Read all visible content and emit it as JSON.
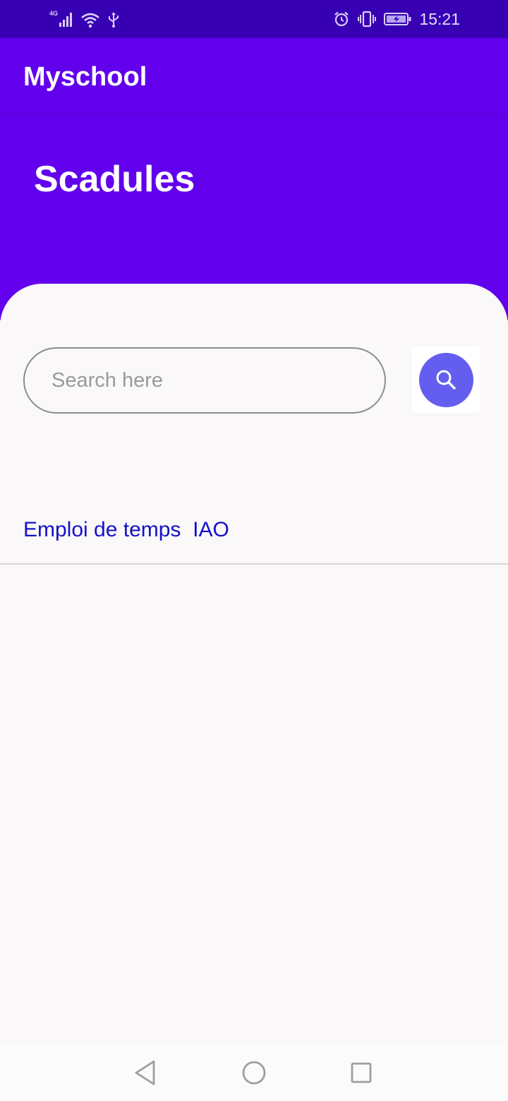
{
  "status_bar": {
    "network_type": "4G",
    "time": "15:21",
    "icons": [
      "signal-icon",
      "wifi-icon",
      "usb-icon",
      "alarm-icon",
      "vibrate-icon",
      "battery-charging-icon"
    ]
  },
  "app_bar": {
    "title": "Myschool"
  },
  "header": {
    "title": "Scadules"
  },
  "search": {
    "placeholder": "Search here",
    "value": "",
    "button_icon": "search-icon"
  },
  "list": {
    "items": [
      {
        "label": "Emploi de temps  IAO"
      }
    ]
  },
  "nav_bar": {
    "icons": [
      "back-icon",
      "home-icon",
      "recents-icon"
    ]
  },
  "colors": {
    "status_bar": "#3700b3",
    "primary": "#6200ee",
    "search_button": "#635ef0",
    "list_text": "#1411c9",
    "background": "#faf8f9"
  }
}
